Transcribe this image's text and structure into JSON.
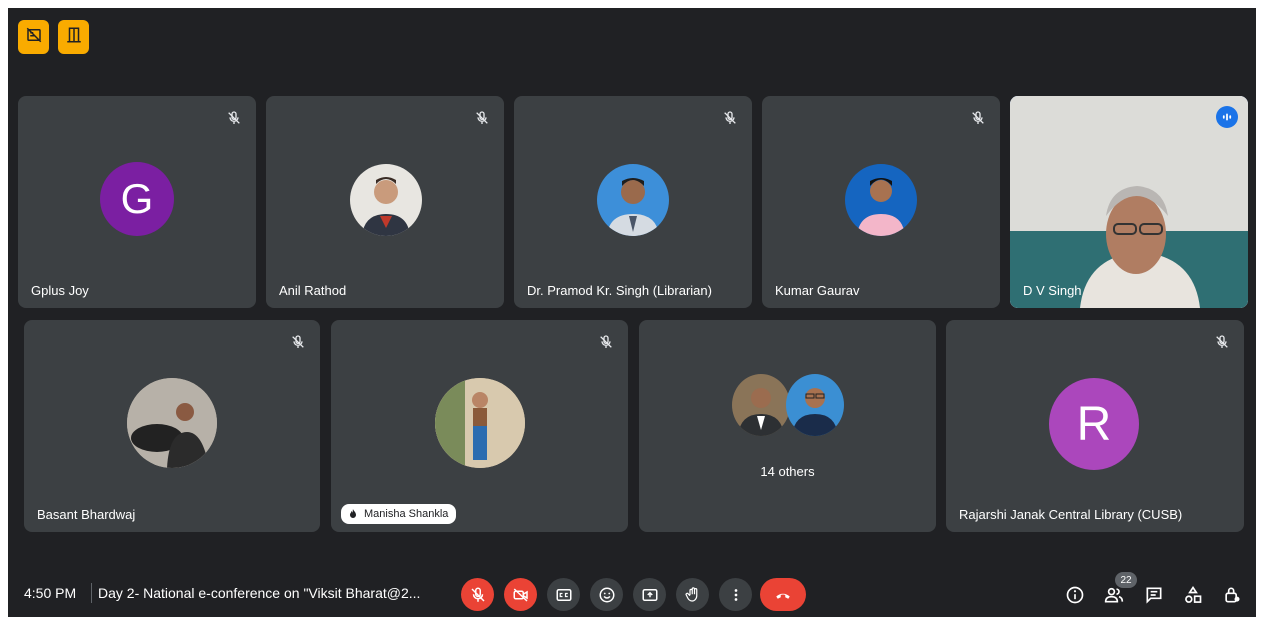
{
  "top_badges": [
    {
      "icon": "no-recording-icon"
    },
    {
      "icon": "companion-mode-icon"
    }
  ],
  "participants_row1": [
    {
      "name": "Gplus Joy",
      "avatar_letter": "G",
      "avatar_color": "#7b1fa2",
      "muted": true
    },
    {
      "name": "Anil Rathod",
      "muted": true
    },
    {
      "name": "Dr. Pramod Kr. Singh (Librarian)",
      "muted": true
    },
    {
      "name": "Kumar Gaurav",
      "muted": true
    },
    {
      "name": "D V Singh",
      "speaking": true
    }
  ],
  "participants_row2": [
    {
      "name": "Basant Bhardwaj",
      "muted": true
    },
    {
      "name": "Manisha Shankla",
      "muted": true
    },
    {
      "others_label": "14 others"
    },
    {
      "name": "Rajarshi Janak Central Library (CUSB)",
      "avatar_letter": "R",
      "avatar_color": "#ab47bc",
      "muted": true
    }
  ],
  "bottom_bar": {
    "time": "4:50 PM",
    "meeting_title": "Day 2- National e-conference on \"Viksit Bharat@2...",
    "participant_count": "22"
  },
  "colors": {
    "background": "#202124",
    "tile": "#3c4043",
    "accent_red": "#ea4335",
    "badge_yellow": "#f9ab00",
    "speaking_outline": "#8ab4f8"
  }
}
